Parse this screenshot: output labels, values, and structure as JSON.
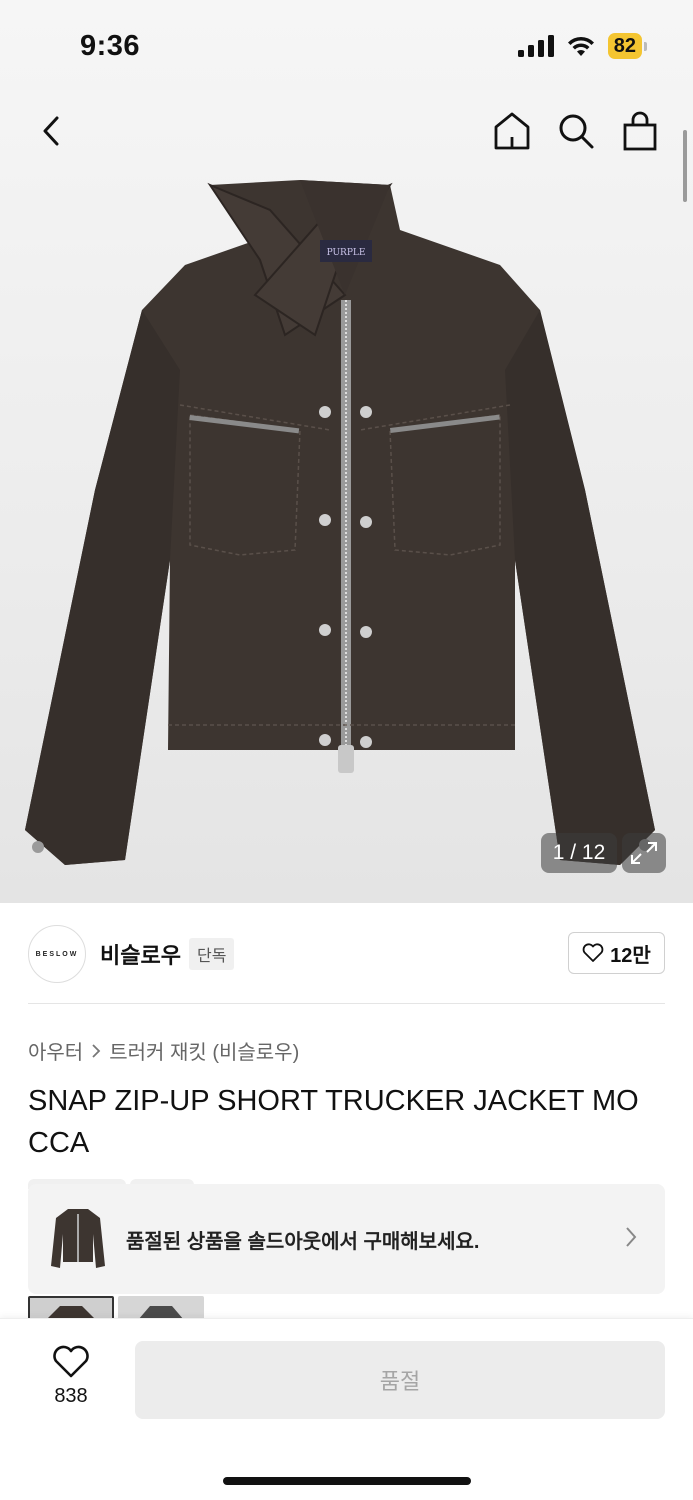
{
  "status": {
    "time": "9:36",
    "battery": "82"
  },
  "nav": {
    "back_icon": "chevron-left-icon",
    "home_icon": "home-icon",
    "search_icon": "search-icon",
    "bag_icon": "shopping-bag-icon"
  },
  "gallery": {
    "counter": "1 / 12",
    "label_text": "PURPLE"
  },
  "brand": {
    "logo_text": "BESLOW",
    "name": "비슬로우",
    "badge": "단독",
    "likes": "12만"
  },
  "breadcrumb": {
    "category": "아우터",
    "subcategory": "트러커 재킷 (비슬로우)"
  },
  "product": {
    "title": "SNAP ZIP-UP SHORT TRUCKER JACKET MOCCA"
  },
  "soldout": {
    "message": "품절된 상품을 솔드아웃에서 구매해보세요."
  },
  "bottom": {
    "wish_count": "838",
    "buy_label": "품절"
  },
  "colors": {
    "jacket": "#3d3530",
    "battery": "#f4c531",
    "card_bg": "#f3f3f3"
  }
}
